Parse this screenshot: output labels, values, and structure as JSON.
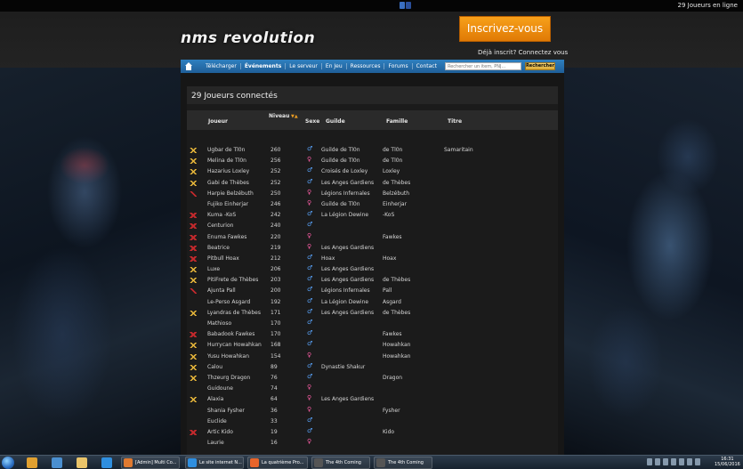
{
  "top": {
    "online_text": "29 Joueurs en ligne"
  },
  "header": {
    "logo": "nms revolution",
    "register_button": "Inscrivez-vous",
    "login_hint": "Déjà inscrit? Connectez vous"
  },
  "nav": {
    "items": [
      "Télécharger",
      "Événements",
      "Le serveur",
      "En Jeu",
      "Ressources",
      "Forums",
      "Contact"
    ],
    "active": "Événements",
    "search_placeholder": "Rechercher un item, PNJ...",
    "search_button": "Rechercher"
  },
  "panel": {
    "title": "29 Joueurs connectés",
    "columns": {
      "player": "Joueur",
      "level": "Niveau",
      "sex": "Sexe",
      "guild": "Guilde",
      "family": "Famille",
      "title": "Titre"
    },
    "rows": [
      {
        "icon": "gold",
        "player": "Ugbar de Tl0n",
        "level": "260",
        "sex": "m",
        "guild": "Guilde de Tl0n",
        "family": "de Tl0n",
        "title": "Samaritain"
      },
      {
        "icon": "gold",
        "player": "Melina de Tl0n",
        "level": "256",
        "sex": "f",
        "guild": "Guilde de Tl0n",
        "family": "de Tl0n",
        "title": ""
      },
      {
        "icon": "gold",
        "player": "Hazarius Loxley",
        "level": "252",
        "sex": "m",
        "guild": "Croisés de Loxley",
        "family": "Loxley",
        "title": ""
      },
      {
        "icon": "gold",
        "player": "Gabi de Thèbes",
        "level": "252",
        "sex": "m",
        "guild": "Les Anges Gardiens",
        "family": "de Thèbes",
        "title": ""
      },
      {
        "icon": "redsmall",
        "player": "Harpie Belzébuth",
        "level": "250",
        "sex": "f",
        "guild": "Légions Infernales",
        "family": "Belzébuth",
        "title": ""
      },
      {
        "icon": "",
        "player": "Fujiko Einherjar",
        "level": "246",
        "sex": "f",
        "guild": "Guilde de Tl0n",
        "family": "Einherjar",
        "title": ""
      },
      {
        "icon": "red",
        "player": "Kuma -KoS",
        "level": "242",
        "sex": "m",
        "guild": "La Légion Dewine",
        "family": "-KoS",
        "title": ""
      },
      {
        "icon": "red",
        "player": "Centurion",
        "level": "240",
        "sex": "m",
        "guild": "",
        "family": "",
        "title": ""
      },
      {
        "icon": "red",
        "player": "Enuma Fawkes",
        "level": "220",
        "sex": "f",
        "guild": "",
        "family": "Fawkes",
        "title": ""
      },
      {
        "icon": "red",
        "player": "Beatrice",
        "level": "219",
        "sex": "f",
        "guild": "Les Anges Gardiens",
        "family": "",
        "title": ""
      },
      {
        "icon": "red",
        "player": "Pitbull Hoax",
        "level": "212",
        "sex": "m",
        "guild": "Hoax",
        "family": "Hoax",
        "title": ""
      },
      {
        "icon": "gold",
        "player": "Luxe",
        "level": "206",
        "sex": "m",
        "guild": "Les Anges Gardiens",
        "family": "",
        "title": ""
      },
      {
        "icon": "gold",
        "player": "PitiFrete de Thèbes",
        "level": "203",
        "sex": "m",
        "guild": "Les Anges Gardiens",
        "family": "de Thèbes",
        "title": ""
      },
      {
        "icon": "redsmall",
        "player": "Ajunta Pall",
        "level": "200",
        "sex": "m",
        "guild": "Légions Infernales",
        "family": "Pall",
        "title": ""
      },
      {
        "icon": "",
        "player": "Le-Perso Asgard",
        "level": "192",
        "sex": "m",
        "guild": "La Légion Dewine",
        "family": "Asgard",
        "title": ""
      },
      {
        "icon": "gold",
        "player": "Lyandras de Thèbes",
        "level": "171",
        "sex": "m",
        "guild": "Les Anges Gardiens",
        "family": "de Thèbes",
        "title": ""
      },
      {
        "icon": "",
        "player": "Mathioso",
        "level": "170",
        "sex": "m",
        "guild": "",
        "family": "",
        "title": ""
      },
      {
        "icon": "red",
        "player": "Babadook Fawkes",
        "level": "170",
        "sex": "m",
        "guild": "",
        "family": "Fawkes",
        "title": ""
      },
      {
        "icon": "gold",
        "player": "Hurrycan Howahkan",
        "level": "168",
        "sex": "m",
        "guild": "",
        "family": "Howahkan",
        "title": ""
      },
      {
        "icon": "gold",
        "player": "Yusu Howahkan",
        "level": "154",
        "sex": "f",
        "guild": "",
        "family": "Howahkan",
        "title": ""
      },
      {
        "icon": "gold",
        "player": "Calou",
        "level": "89",
        "sex": "m",
        "guild": "Dynastie Shakur",
        "family": "",
        "title": ""
      },
      {
        "icon": "gold",
        "player": "Thzeurg Dragon",
        "level": "76",
        "sex": "m",
        "guild": "",
        "family": "Dragon",
        "title": ""
      },
      {
        "icon": "",
        "player": "Guidoune",
        "level": "74",
        "sex": "f",
        "guild": "",
        "family": "",
        "title": ""
      },
      {
        "icon": "gold",
        "player": "Alaxia",
        "level": "64",
        "sex": "f",
        "guild": "Les Anges Gardiens",
        "family": "",
        "title": ""
      },
      {
        "icon": "",
        "player": "Shania Fysher",
        "level": "36",
        "sex": "f",
        "guild": "",
        "family": "Fysher",
        "title": ""
      },
      {
        "icon": "",
        "player": "Euclide",
        "level": "33",
        "sex": "m",
        "guild": "",
        "family": "",
        "title": ""
      },
      {
        "icon": "red",
        "player": "Artic Kido",
        "level": "19",
        "sex": "m",
        "guild": "",
        "family": "Kido",
        "title": ""
      },
      {
        "icon": "",
        "player": "Laurie",
        "level": "16",
        "sex": "f",
        "guild": "",
        "family": "",
        "title": ""
      }
    ]
  },
  "taskbar": {
    "items": [
      "[Admin] Multi Co...",
      "Le site internet N...",
      "La quatrième Pro...",
      "The 4th Coming",
      "The 4th Coming"
    ],
    "time": "16:31",
    "date": "15/06/2016"
  },
  "colors": {
    "accent": "#2f7fbf",
    "register": "#f39a16",
    "male": "#5aa6ff",
    "female": "#ff5fa8"
  }
}
